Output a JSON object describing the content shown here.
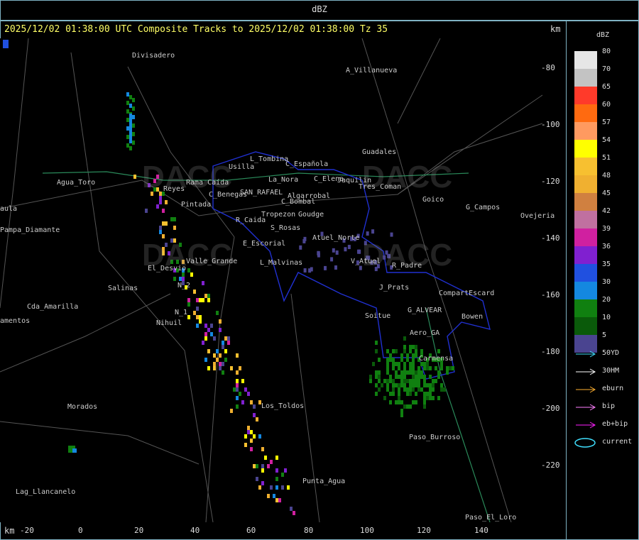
{
  "header": {
    "title": "dBZ"
  },
  "map": {
    "title": "2025/12/02 01:38:00 UTC Composite Tracks to 2025/12/02 01:38:00 Tz 35",
    "unit_top": "km",
    "unit_bottom": "km",
    "x_ticks": [
      "-20",
      "0",
      "20",
      "40",
      "60",
      "80",
      "100",
      "120",
      "140"
    ],
    "y_ticks": [
      "-80",
      "-100",
      "-120",
      "-140",
      "-160",
      "-180",
      "-200",
      "-220"
    ],
    "watermark": "DACC",
    "places": [
      {
        "name": "Divisadero"
      },
      {
        "name": "A_Villanueva"
      },
      {
        "name": "Guadales"
      },
      {
        "name": "L_Tombina"
      },
      {
        "name": "C_Española"
      },
      {
        "name": "Usilla"
      },
      {
        "name": "La_Nora"
      },
      {
        "name": "C_Elena"
      },
      {
        "name": "Jaquilin"
      },
      {
        "name": "Tres_Coman"
      },
      {
        "name": "Agua_Toro"
      },
      {
        "name": "Reyes"
      },
      {
        "name": "Rama Caída"
      },
      {
        "name": "C_Benegas"
      },
      {
        "name": "SAN_RAFAEL"
      },
      {
        "name": "Algarrobal"
      },
      {
        "name": "C_Bombal"
      },
      {
        "name": "Goico"
      },
      {
        "name": "G_Campos"
      },
      {
        "name": "Pampa_Diamante"
      },
      {
        "name": "Pintada"
      },
      {
        "name": "R_Caida"
      },
      {
        "name": "Tropezon"
      },
      {
        "name": "Goudge"
      },
      {
        "name": "S_Rosas"
      },
      {
        "name": "Atuel_Norte"
      },
      {
        "name": "E_Escorial"
      },
      {
        "name": "V_Atuel"
      },
      {
        "name": "R_Padre"
      },
      {
        "name": "El_Desvio"
      },
      {
        "name": "Valle_Grande"
      },
      {
        "name": "L_Malvinas"
      },
      {
        "name": "Salinas"
      },
      {
        "name": "N_2"
      },
      {
        "name": "Cda_Amarilla"
      },
      {
        "name": "N_1"
      },
      {
        "name": "Nihuil"
      },
      {
        "name": "J_Prats"
      },
      {
        "name": "CompartEscard"
      },
      {
        "name": "G_ALVEAR"
      },
      {
        "name": "Soitue"
      },
      {
        "name": "Bowen"
      },
      {
        "name": "Aero_GA"
      },
      {
        "name": "Carmensa"
      },
      {
        "name": "Morados"
      },
      {
        "name": "Los_Toldos"
      },
      {
        "name": "Paso_Burroso"
      },
      {
        "name": "Punta_Agua"
      },
      {
        "name": "Lag_Llancanelo"
      },
      {
        "name": "Paso_El_Loro"
      },
      {
        "name": "Ovejeria"
      },
      {
        "name": "amentos"
      },
      {
        "name": "aula"
      }
    ]
  },
  "legend": {
    "title": "dBZ",
    "levels": [
      {
        "label": "80",
        "color": "#e6e6e6"
      },
      {
        "label": "70",
        "color": "#c3c3c3"
      },
      {
        "label": "65",
        "color": "#ff3a2a"
      },
      {
        "label": "60",
        "color": "#ff6a10"
      },
      {
        "label": "57",
        "color": "#ff9a60"
      },
      {
        "label": "54",
        "color": "#ffff00"
      },
      {
        "label": "51",
        "color": "#f7c030"
      },
      {
        "label": "48",
        "color": "#f0b030"
      },
      {
        "label": "45",
        "color": "#d08040"
      },
      {
        "label": "42",
        "color": "#c070a0"
      },
      {
        "label": "39",
        "color": "#d020a0"
      },
      {
        "label": "36",
        "color": "#8020d0"
      },
      {
        "label": "35",
        "color": "#2050e0"
      },
      {
        "label": "30",
        "color": "#1488e0"
      },
      {
        "label": "20",
        "color": "#108010"
      },
      {
        "label": "10",
        "color": "#0a5a0a"
      },
      {
        "label": "5",
        "color": "#4a4490"
      }
    ],
    "tracks": [
      {
        "label": "50YD",
        "color": "#40e0ff"
      },
      {
        "label": "30HM",
        "color": "#ffffff"
      },
      {
        "label": "eburn",
        "color": "#ffb030"
      },
      {
        "label": "bip",
        "color": "#ff80ff"
      },
      {
        "label": "eb+bip",
        "color": "#ff20ff"
      },
      {
        "label": "current",
        "color": "#40e0ff"
      }
    ]
  }
}
